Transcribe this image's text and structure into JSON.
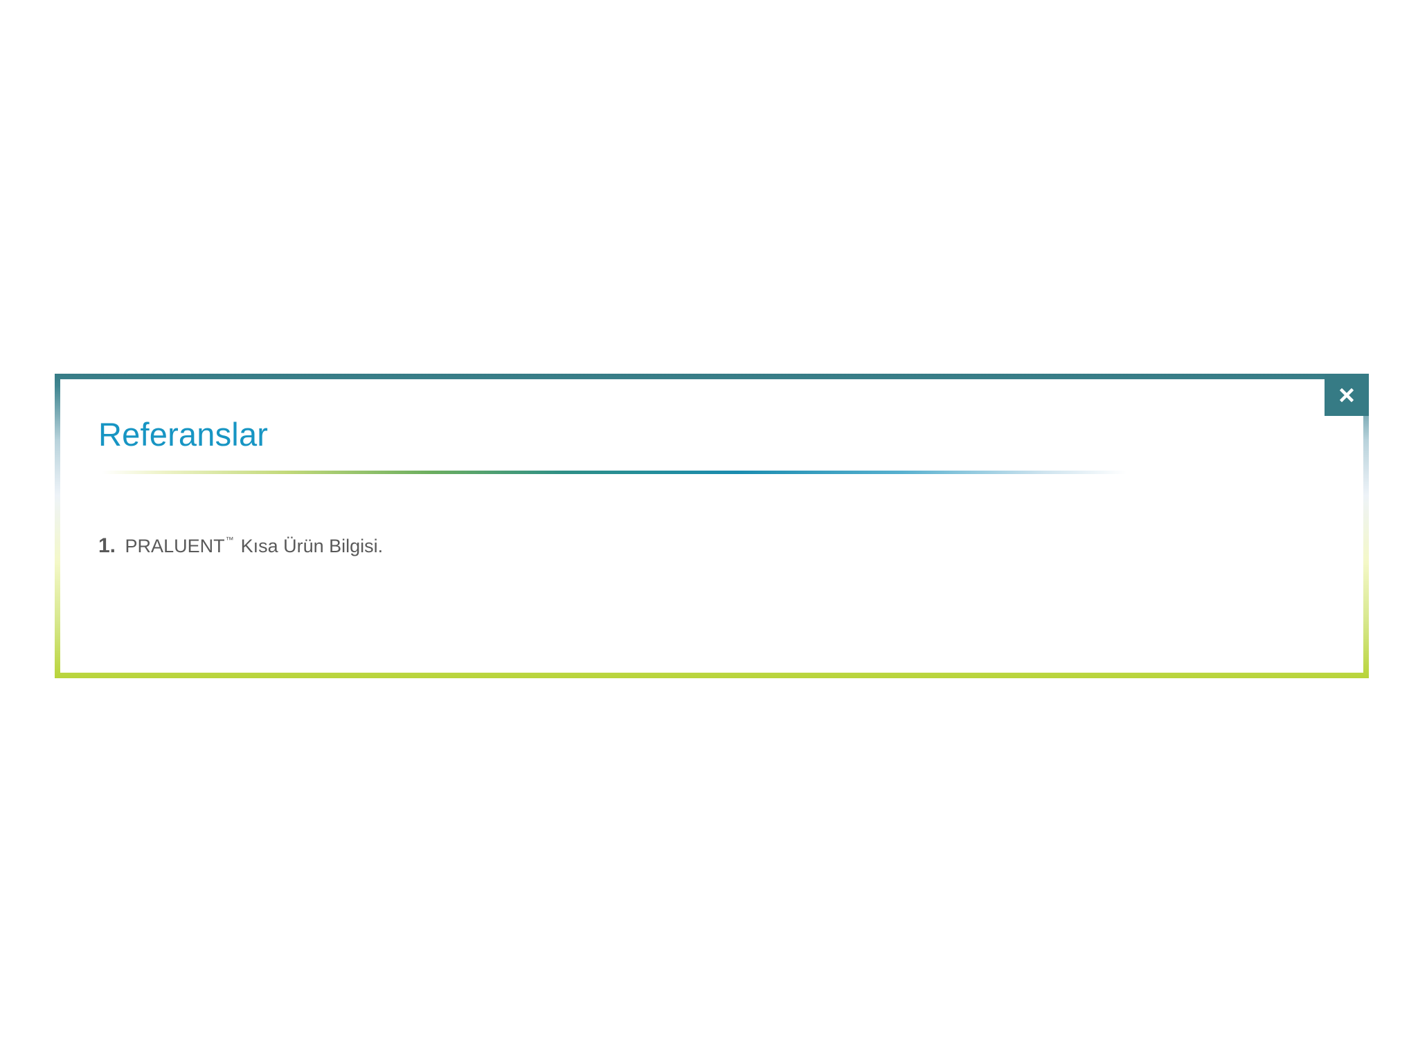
{
  "modal": {
    "title": "Referanslar",
    "close_icon": "close-icon",
    "colors": {
      "title": "#1795c3",
      "close_button_bg": "#367b85",
      "border_top": "#367b85",
      "border_bottom": "#b8d43a",
      "text": "#595959"
    },
    "references": [
      {
        "number": "1.",
        "product": "PRALUENT",
        "trademark": "™",
        "text": "Kısa Ürün Bilgisi."
      }
    ]
  }
}
